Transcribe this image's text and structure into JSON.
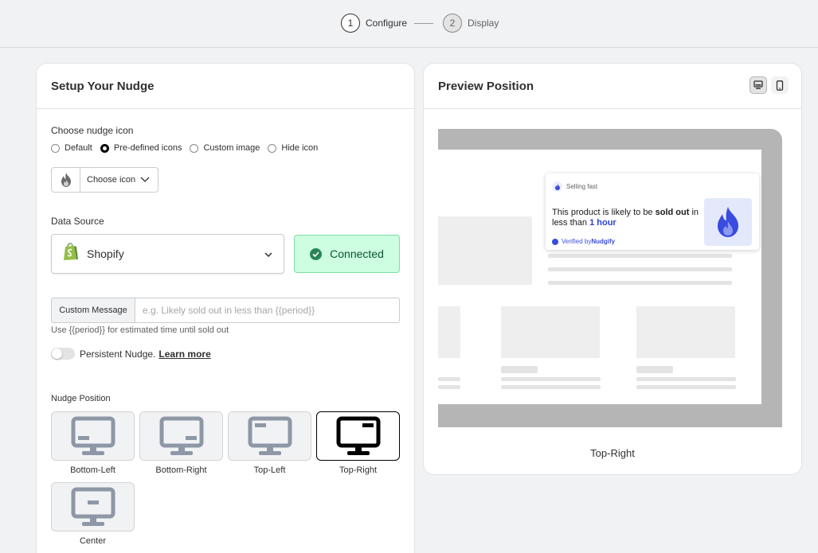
{
  "stepper": {
    "steps": [
      {
        "num": "1",
        "label": "Configure"
      },
      {
        "num": "2",
        "label": "Display"
      }
    ]
  },
  "setup": {
    "title": "Setup Your Nudge",
    "icon_section": {
      "label": "Choose nudge icon",
      "options": [
        "Default",
        "Pre-defined icons",
        "Custom image",
        "Hide icon"
      ],
      "selected": "Pre-defined icons",
      "choose_label": "Choose icon"
    },
    "data_source": {
      "label": "Data Source",
      "value": "Shopify",
      "status": "Connected"
    },
    "custom_message": {
      "prefix": "Custom Message",
      "value": "",
      "placeholder": "e.g. Likely sold out in less than {{period}}",
      "help": "Use {{period}} for estimated time until sold out"
    },
    "persistent": {
      "label": "Persistent Nudge.",
      "link": "Learn more",
      "enabled": false
    },
    "position": {
      "label": "Nudge Position",
      "options": [
        "Bottom-Left",
        "Bottom-Right",
        "Top-Left",
        "Top-Right",
        "Center"
      ],
      "selected": "Top-Right"
    }
  },
  "preview": {
    "title": "Preview Position",
    "device": "desktop",
    "caption": "Top-Right",
    "nudge": {
      "badge": "Selling fast",
      "message_pre": "This product is likely to be ",
      "message_bold": "sold out",
      "message_mid": " in less than ",
      "message_highlight": "1 hour",
      "verified_pre": "Verified by ",
      "verified_brand": "Nudgify"
    }
  },
  "colors": {
    "accent_blue": "#2b3fd8",
    "connected_bg": "#cdfee1",
    "connected_check": "#29845a",
    "shopify_green": "#95bf47"
  }
}
